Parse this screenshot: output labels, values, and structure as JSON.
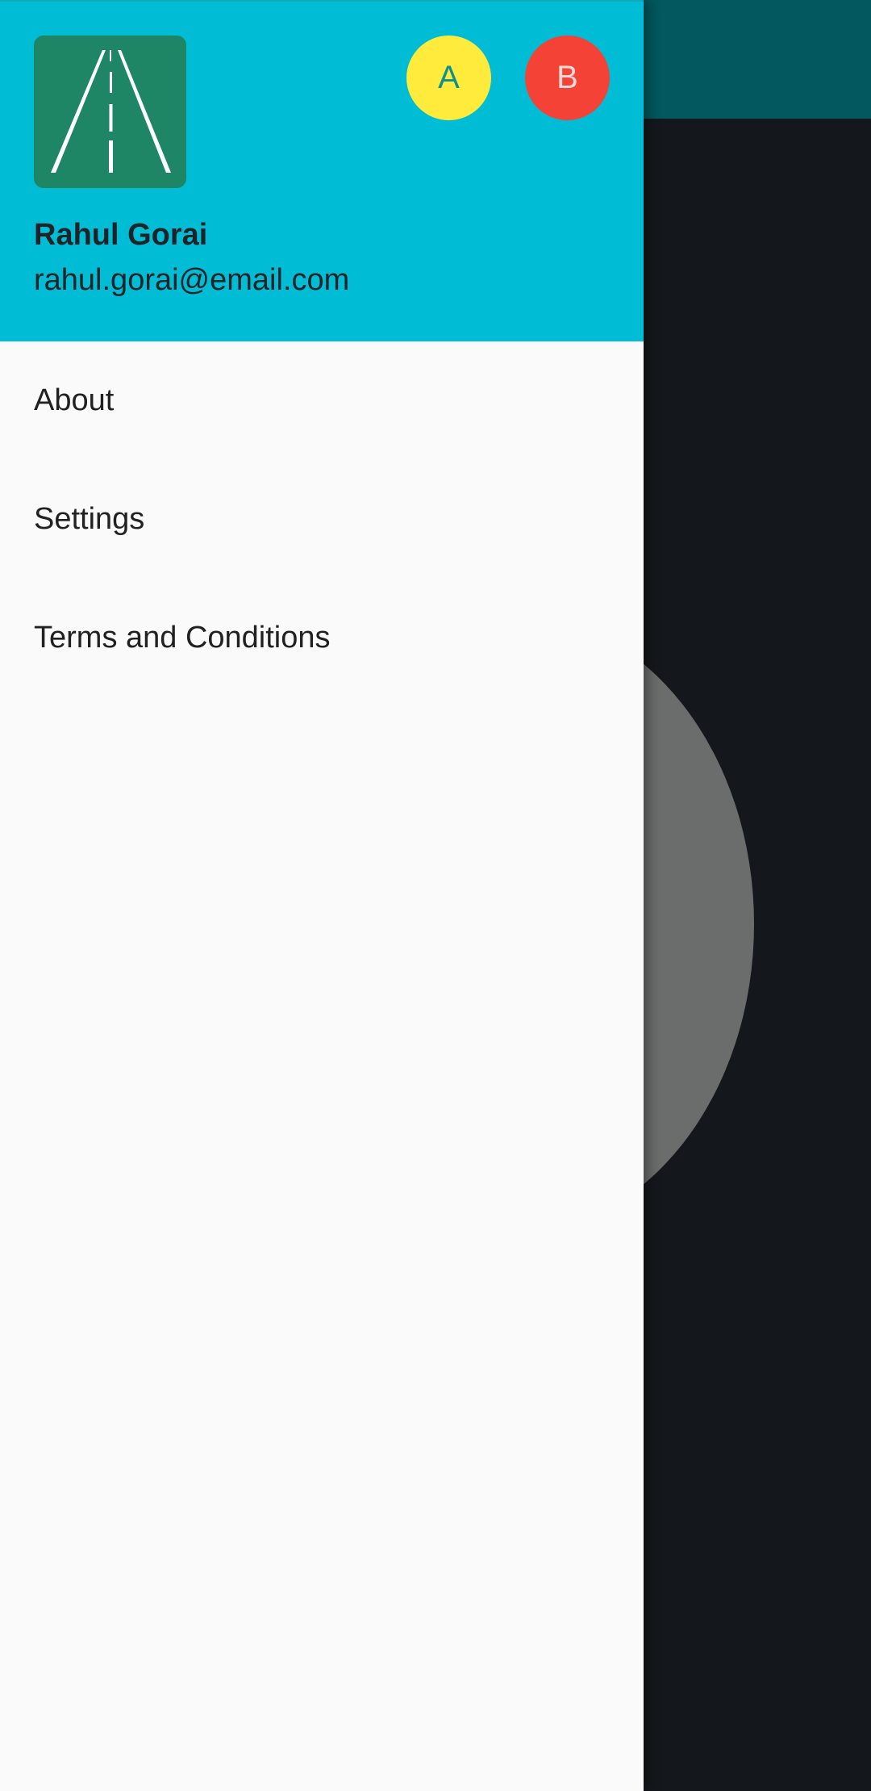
{
  "background_app": {
    "appbar_color": "#02585e",
    "body_color": "#14181c"
  },
  "drawer": {
    "header": {
      "color": "#00bcd4",
      "logo": {
        "icon": "road-icon",
        "color": "#1e8664"
      },
      "accounts": [
        {
          "initial": "A",
          "color": "#ffeb3b"
        },
        {
          "initial": "B",
          "color": "#f44336"
        }
      ],
      "name": "Rahul Gorai",
      "email": "rahul.gorai@email.com"
    },
    "items": [
      {
        "label": "About"
      },
      {
        "label": "Settings"
      },
      {
        "label": "Terms and Conditions"
      }
    ]
  }
}
